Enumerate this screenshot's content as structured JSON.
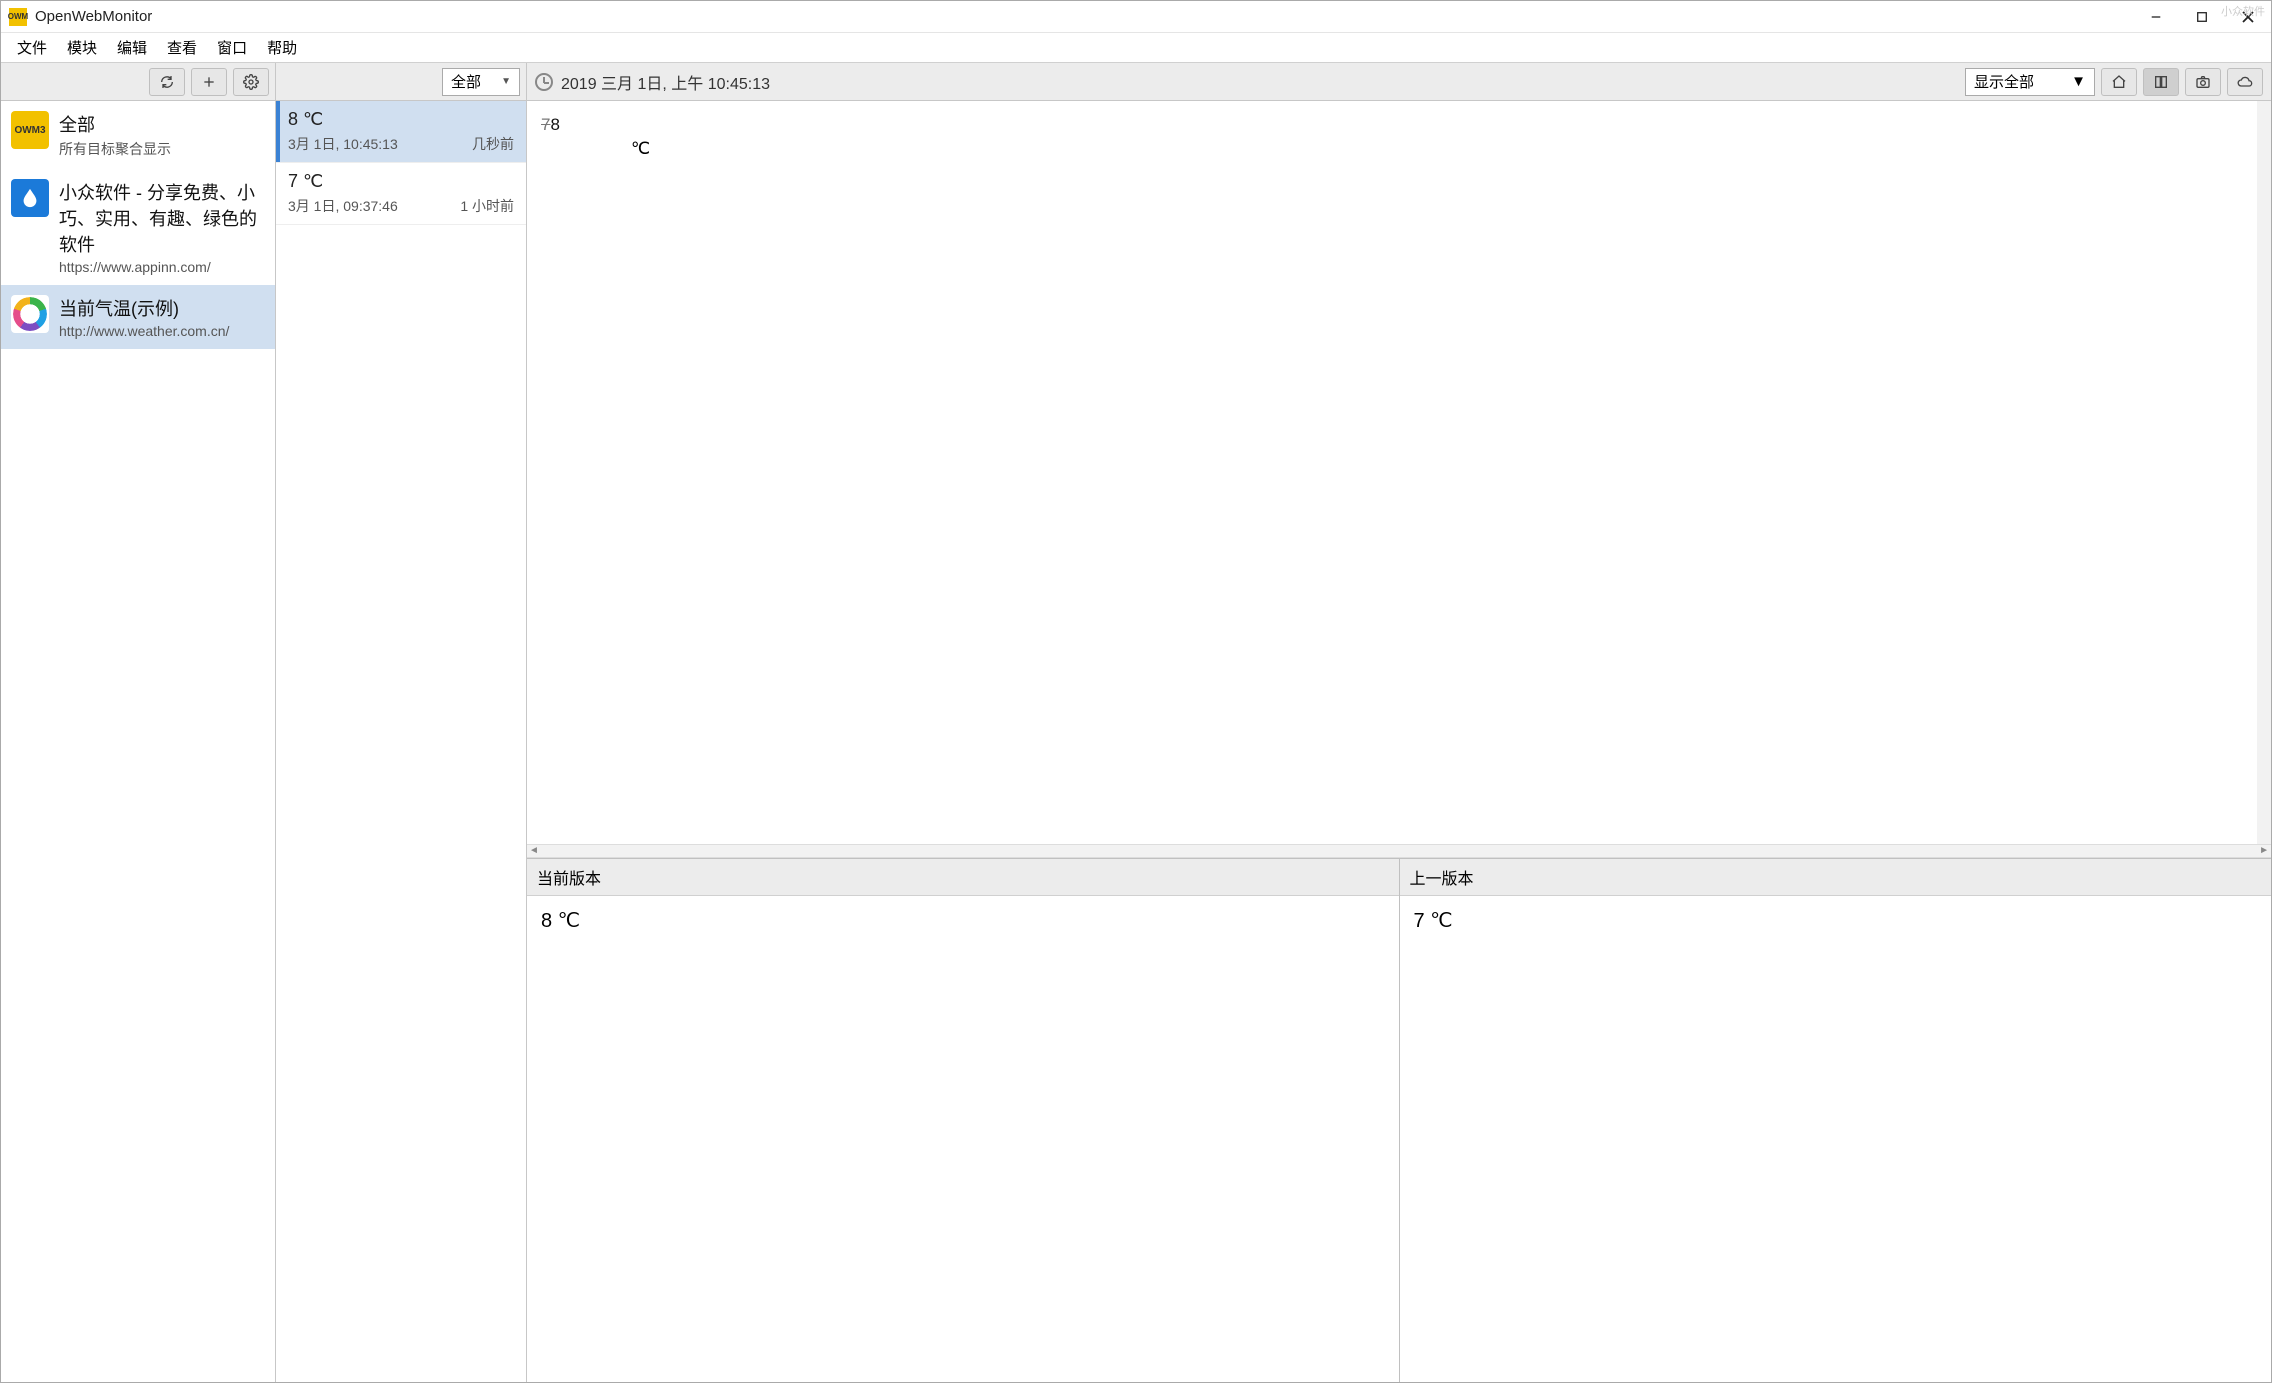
{
  "app": {
    "title": "OpenWebMonitor",
    "icon_text": "OWM",
    "watermark": "小众软件"
  },
  "menu": {
    "items": [
      "文件",
      "模块",
      "编辑",
      "查看",
      "窗口",
      "帮助"
    ]
  },
  "toolbar": {
    "filter_select": "全部",
    "timestamp": "2019 三月 1日, 上午 10:45:13",
    "display_select": "显示全部"
  },
  "sidebar": {
    "items": [
      {
        "title": "全部",
        "subtitle": "所有目标聚合显示",
        "icon": "all",
        "icon_text": "OWM3",
        "selected": false
      },
      {
        "title": "小众软件 - 分享免费、小巧、实用、有趣、绿色的软件",
        "subtitle": "https://www.appinn.com/",
        "icon": "drop",
        "selected": false
      },
      {
        "title": "当前气温(示例)",
        "subtitle": "http://www.weather.com.cn/",
        "icon": "weather",
        "selected": true
      }
    ]
  },
  "events": [
    {
      "title": "8 ℃",
      "time": "3月 1日, 10:45:13",
      "relative": "几秒前",
      "selected": true
    },
    {
      "title": "7 ℃",
      "time": "3月 1日, 09:37:46",
      "relative": "1 小时前",
      "selected": false
    }
  ],
  "diff": {
    "old": "7",
    "new": "8",
    "unit": "℃"
  },
  "compare": {
    "current_label": "当前版本",
    "previous_label": "上一版本",
    "current_value": "8  ℃",
    "previous_value": "7  ℃"
  }
}
